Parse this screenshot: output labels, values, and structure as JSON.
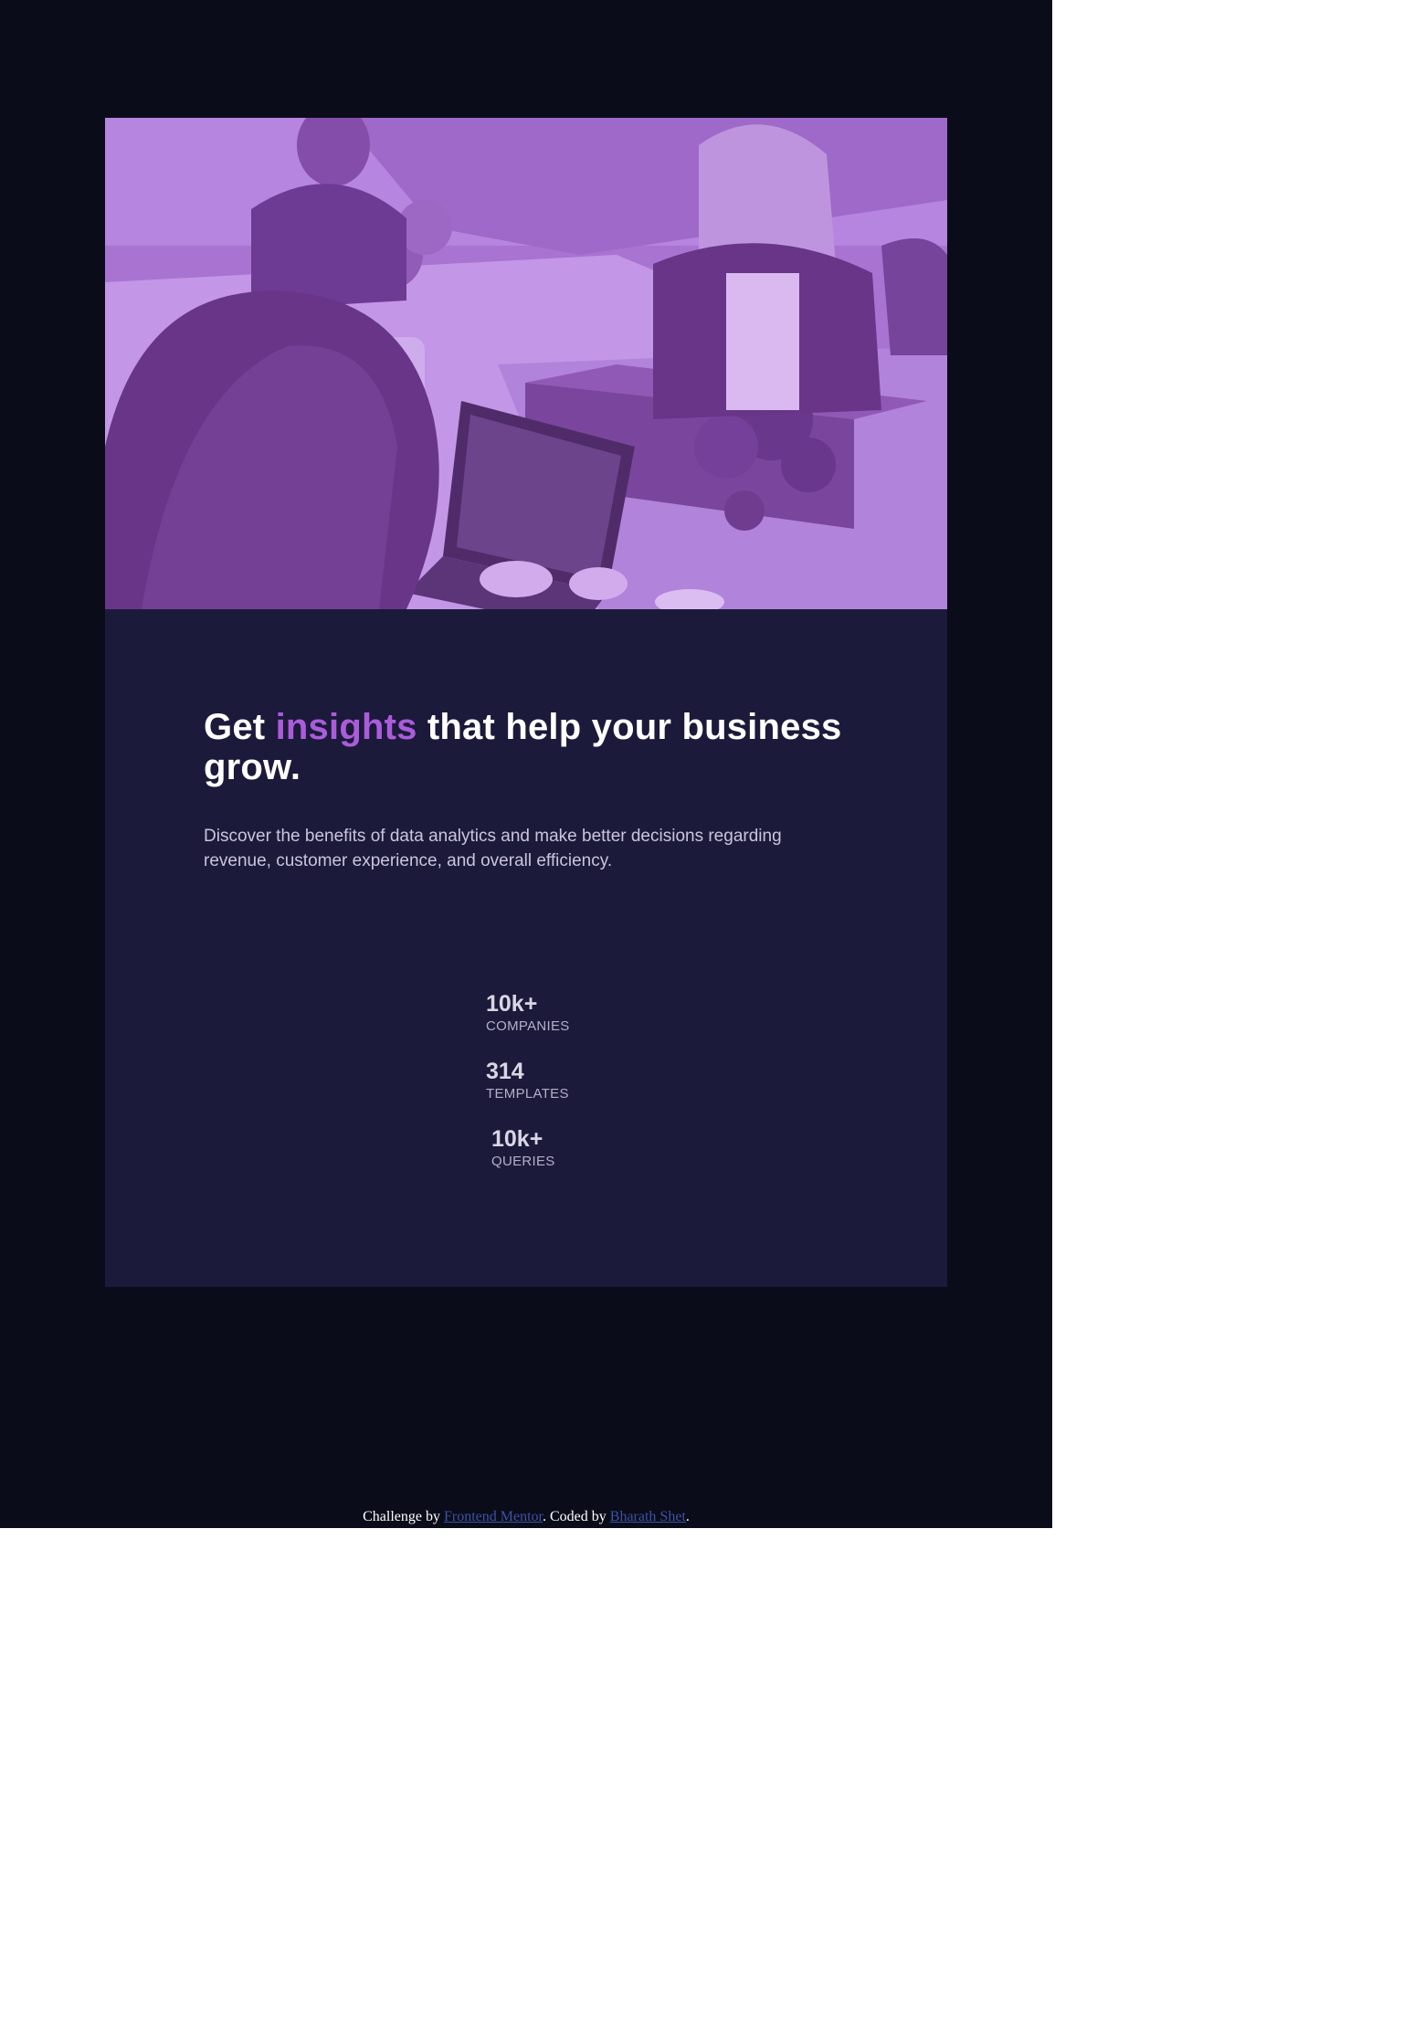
{
  "colors": {
    "page_background": "#0a0c1a",
    "card_background": "#1c1a3a",
    "accent": "#aa5cdb",
    "image_tint": "#aa5cdb",
    "link": "#3e52a3"
  },
  "hero": {
    "image_description_icon": "team-office-photo-icon"
  },
  "content": {
    "headline_part1": "Get",
    "headline_accent": "insights",
    "headline_part2": "that help your business grow.",
    "description": "Discover the benefits of data analytics and make better decisions regarding revenue, customer experience, and overall efficiency."
  },
  "stats": [
    {
      "value": "10k+",
      "label": "COMPANIES"
    },
    {
      "value": "314",
      "label": "TEMPLATES"
    },
    {
      "value": "10k+",
      "label": "QUERIES"
    }
  ],
  "footer": {
    "prefix": "Challenge by",
    "link1": "Frontend Mentor",
    "middle": ". Coded by",
    "link2": "Bharath Shet",
    "suffix": "."
  }
}
